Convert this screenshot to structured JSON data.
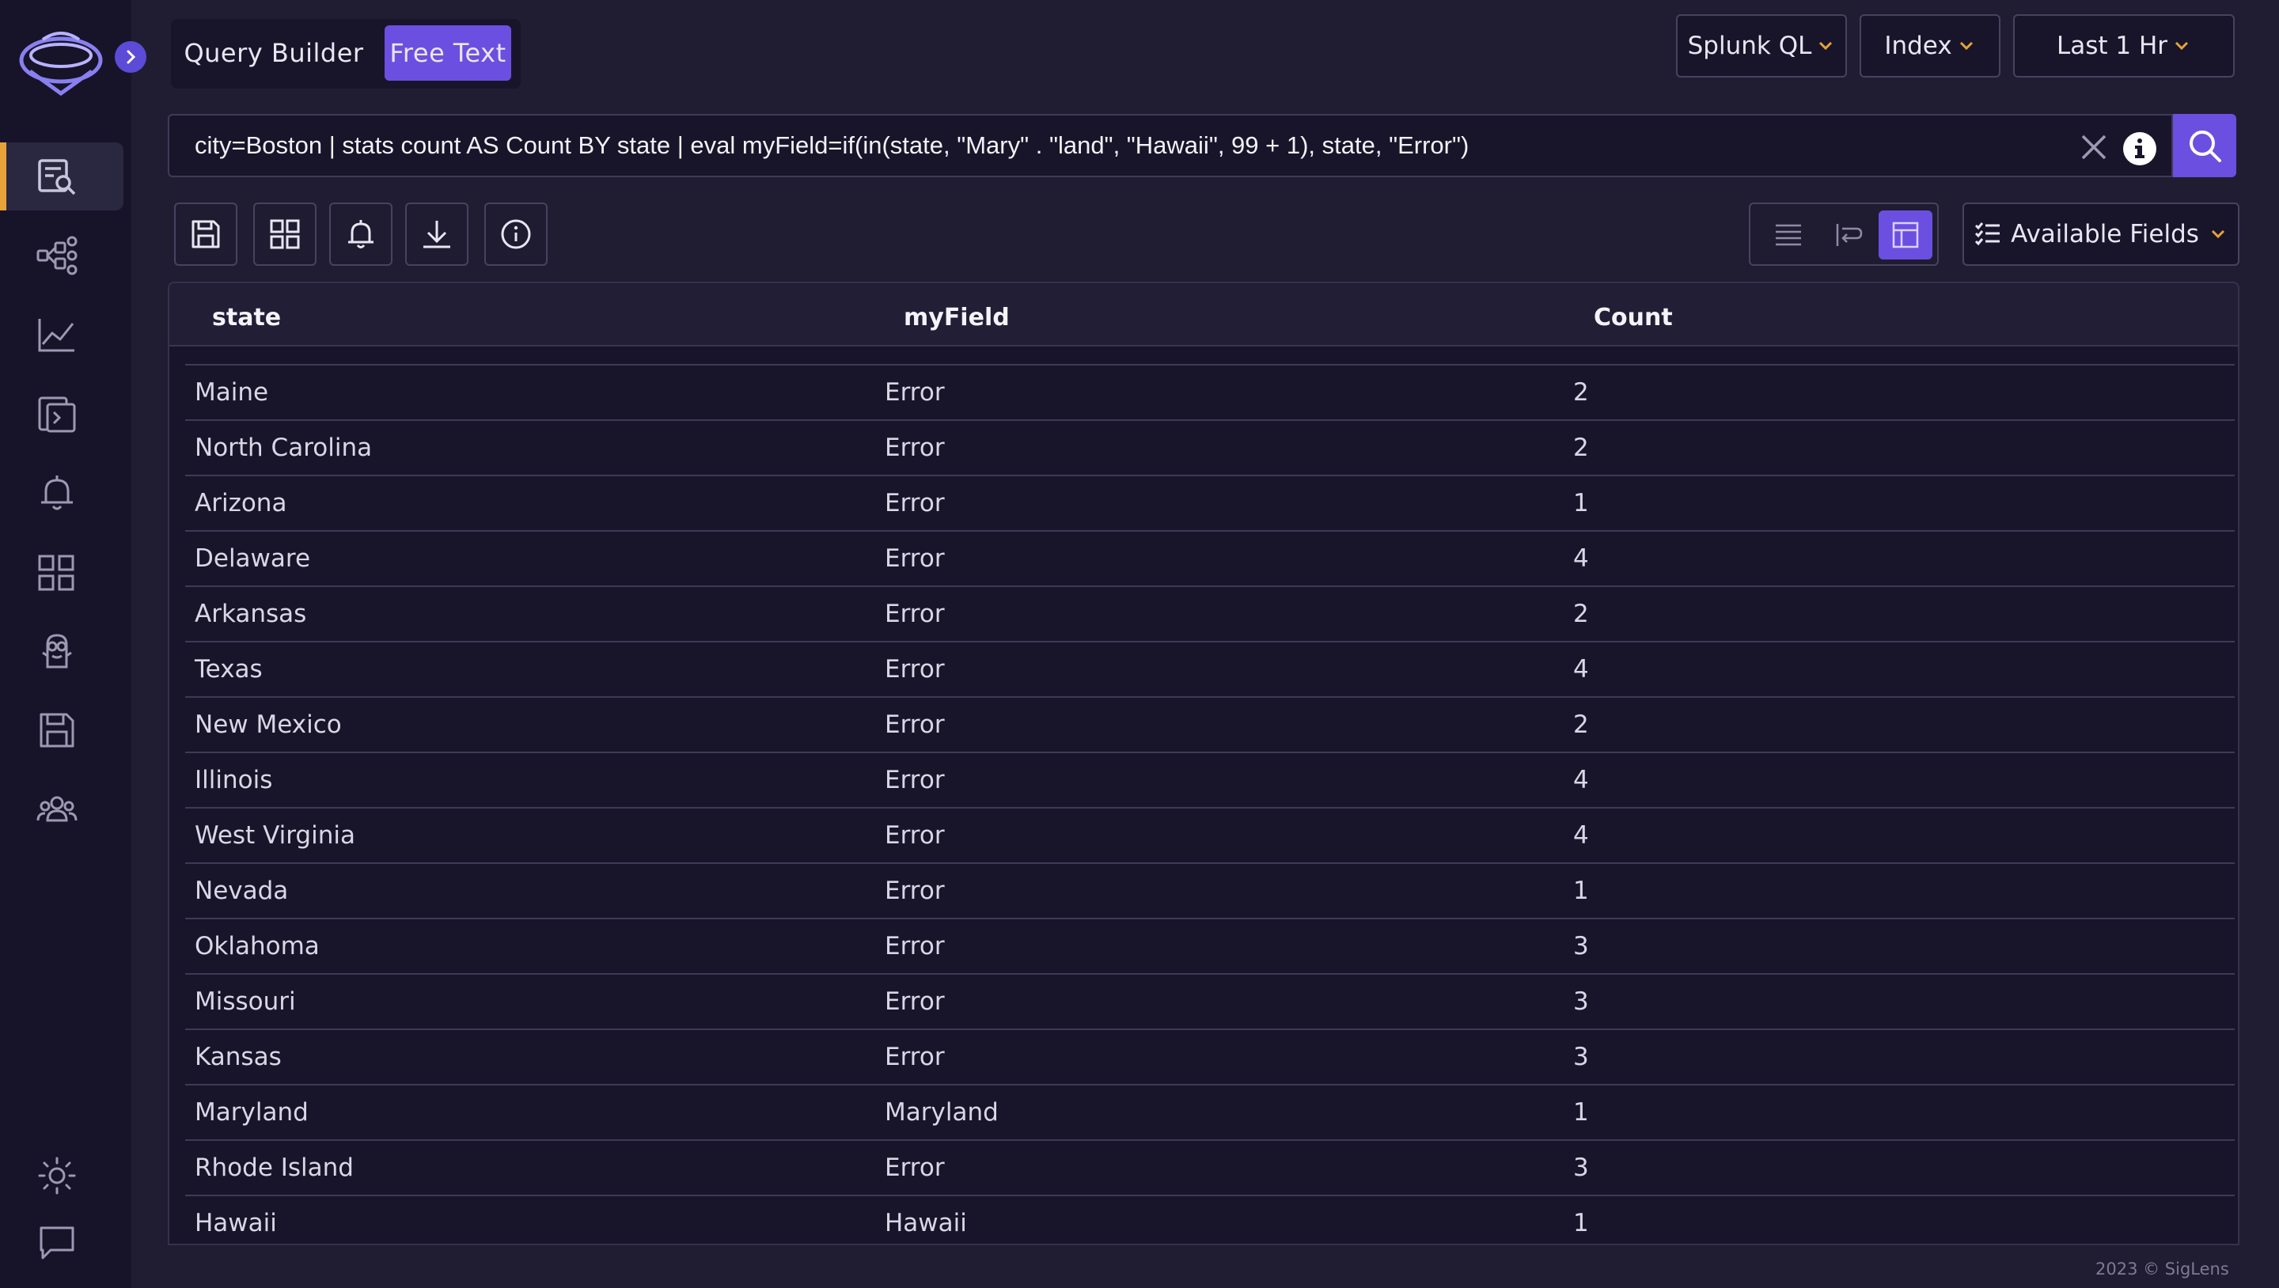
{
  "app": {
    "name": "SigLens",
    "footer": "2023 © SigLens"
  },
  "sidebar": {
    "items": [
      {
        "icon": "search-logs-icon",
        "active": true
      },
      {
        "icon": "service-graph-icon",
        "active": false
      },
      {
        "icon": "metrics-chart-icon",
        "active": false
      },
      {
        "icon": "terminal-file-icon",
        "active": false
      },
      {
        "icon": "alerts-bell-icon",
        "active": false
      },
      {
        "icon": "dashboards-grid-icon",
        "active": false
      },
      {
        "icon": "minion-bot-icon",
        "active": false
      },
      {
        "icon": "saved-queries-icon",
        "active": false
      },
      {
        "icon": "users-group-icon",
        "active": false
      }
    ],
    "bottom": [
      "sun-theme-icon",
      "chat-feedback-icon"
    ]
  },
  "mode": {
    "query_builder": "Query Builder",
    "free_text": "Free Text"
  },
  "header": {
    "language": "Splunk QL",
    "index": "Index",
    "time_range": "Last 1 Hr"
  },
  "search": {
    "query": "city=Boston | stats count AS Count BY state | eval myField=if(in(state, \"Mary\" . \"land\", \"Hawaii\", 99 + 1), state, \"Error\")"
  },
  "toolbar": {
    "available_fields": "Available Fields"
  },
  "colors": {
    "accent": "#6b4fe0",
    "active_marker": "#e7a23a",
    "background": "#201d33",
    "sidebar": "#17142a"
  },
  "table": {
    "columns": [
      "state",
      "myField",
      "Count"
    ],
    "rows": [
      [
        "Maine",
        "Error",
        "2"
      ],
      [
        "North Carolina",
        "Error",
        "2"
      ],
      [
        "Arizona",
        "Error",
        "1"
      ],
      [
        "Delaware",
        "Error",
        "4"
      ],
      [
        "Arkansas",
        "Error",
        "2"
      ],
      [
        "Texas",
        "Error",
        "4"
      ],
      [
        "New Mexico",
        "Error",
        "2"
      ],
      [
        "Illinois",
        "Error",
        "4"
      ],
      [
        "West Virginia",
        "Error",
        "4"
      ],
      [
        "Nevada",
        "Error",
        "1"
      ],
      [
        "Oklahoma",
        "Error",
        "3"
      ],
      [
        "Missouri",
        "Error",
        "3"
      ],
      [
        "Kansas",
        "Error",
        "3"
      ],
      [
        "Maryland",
        "Maryland",
        "1"
      ],
      [
        "Rhode Island",
        "Error",
        "3"
      ],
      [
        "Hawaii",
        "Hawaii",
        "1"
      ]
    ]
  }
}
